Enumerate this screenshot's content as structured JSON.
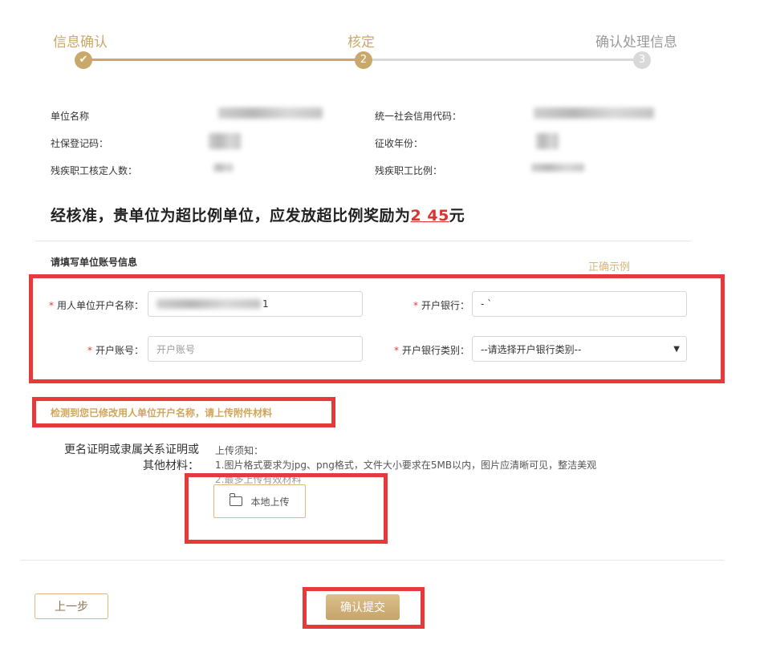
{
  "steps": [
    {
      "label": "信息确认",
      "badge": "✔"
    },
    {
      "label": "核定",
      "badge": "2"
    },
    {
      "label": "确认处理信息",
      "badge": "3"
    }
  ],
  "unit_info": {
    "name_label": "单位名称",
    "credit_code_label": "统一社会信用代码：",
    "social_security_label": "社保登记码：",
    "collection_year_label": "征收年份：",
    "disabled_count_label": "残疾职工核定人数：",
    "disabled_ratio_label": "残疾职工比例："
  },
  "headline": {
    "text": "经核准，贵单位为超比例单位，应发放超比例奖励为",
    "amount": "2 45",
    "unit": "元"
  },
  "account_section": {
    "title": "请填写单位账号信息",
    "example_link": "正确示例"
  },
  "form": {
    "required_mark": "*",
    "account_name_label": "用人单位开户名称：",
    "account_name_value": "1",
    "bank_label": "开户银行：",
    "bank_value": "- `",
    "account_no_label": "开户账号：",
    "account_no_placeholder": "开户账号",
    "bank_type_label": "开户银行类别：",
    "bank_type_value": "--请选择开户银行类别--"
  },
  "warning": "检测到您已修改用人单位开户名称，请上传附件材料",
  "attachment": {
    "label_line1": "更名证明或隶属关系证明或",
    "label_line2": "其他材料：",
    "notice_title": "上传须知：",
    "notice_1": "1.图片格式要求为jpg、png格式，文件大小要求在5MB以内，图片应清晰可见，整洁美观",
    "notice_2": "2.最多上传有效材料",
    "upload_button": "本地上传"
  },
  "actions": {
    "prev": "上一步",
    "submit": "确认提交"
  },
  "colors": {
    "gold": "#c9a86a",
    "highlight_red": "#e8393a",
    "amount_red": "#e0302f"
  }
}
